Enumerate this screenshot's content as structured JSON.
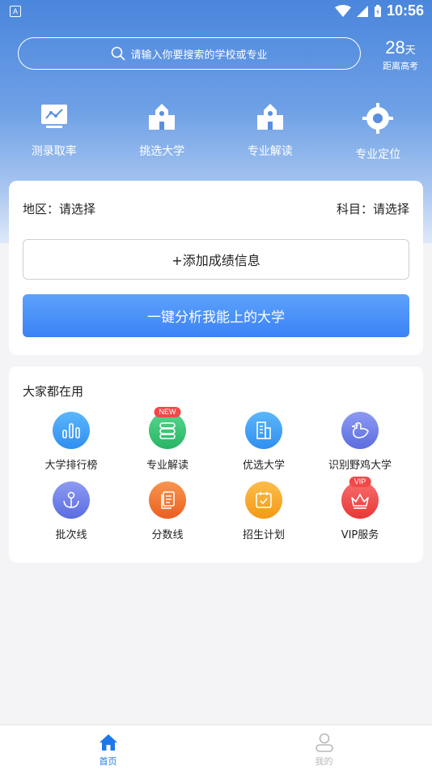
{
  "status_bar": {
    "time": "10:56",
    "notification_letter": "A"
  },
  "search": {
    "placeholder": "请输入你要搜索的学校或专业"
  },
  "countdown": {
    "days": "28",
    "unit": "天",
    "label": "距离高考"
  },
  "quick_actions": [
    {
      "label": "测录取率",
      "icon": "trend-chart-icon"
    },
    {
      "label": "挑选大学",
      "icon": "university-building-icon"
    },
    {
      "label": "专业解读",
      "icon": "university-building-icon"
    },
    {
      "label": "专业定位",
      "icon": "location-target-icon"
    }
  ],
  "score_card": {
    "region_label": "地区：请选择",
    "subject_label": "科目：请选择",
    "add_button": "+添加成绩信息",
    "analyze_button": "一键分析我能上的大学"
  },
  "tools_section": {
    "title": "大家都在用",
    "items": [
      {
        "label": "大学排行榜",
        "icon": "bar-chart-icon",
        "color": "#3aa0f5",
        "badge": ""
      },
      {
        "label": "专业解读",
        "icon": "book-icon",
        "color": "#34c47a",
        "badge": "NEW"
      },
      {
        "label": "优选大学",
        "icon": "building-icon",
        "color": "#3aa0f5",
        "badge": ""
      },
      {
        "label": "识别野鸡大学",
        "icon": "bird-icon",
        "color": "#6d7fe8",
        "badge": ""
      },
      {
        "label": "批次线",
        "icon": "anchor-icon",
        "color": "#6d7fe8",
        "badge": ""
      },
      {
        "label": "分数线",
        "icon": "document-icon",
        "color": "#f07a32",
        "badge": ""
      },
      {
        "label": "招生计划",
        "icon": "calendar-check-icon",
        "color": "#f6a623",
        "badge": ""
      },
      {
        "label": "VIP服务",
        "icon": "crown-icon",
        "color": "#f04848",
        "badge": "VIP"
      }
    ]
  },
  "tab_bar": [
    {
      "label": "首页",
      "icon": "home-icon",
      "active": true,
      "color": "#1f78ea"
    },
    {
      "label": "我的",
      "icon": "person-icon",
      "active": false,
      "color": "#b8b8b8"
    }
  ]
}
